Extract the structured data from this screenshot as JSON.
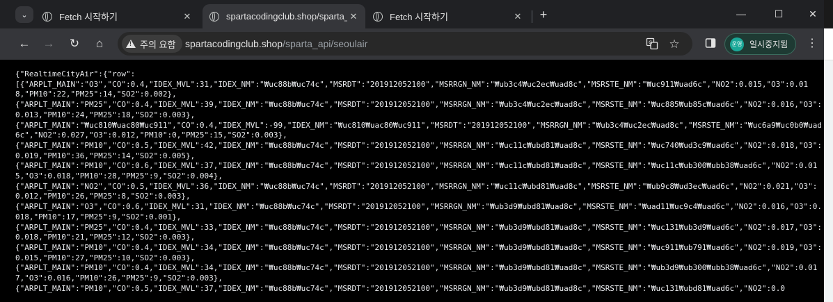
{
  "tabs": [
    {
      "title": "Fetch 시작하기"
    },
    {
      "title": "spartacodingclub.shop/sparta_"
    },
    {
      "title": "Fetch 시작하기"
    }
  ],
  "tabstrip": {
    "search_icon": "chevron-down-icon",
    "close": "✕",
    "new_tab": "+",
    "minimize": "—",
    "maximize": "☐",
    "window_close": "✕"
  },
  "toolbar": {
    "back": "←",
    "forward": "→",
    "reload": "↻",
    "home": "⌂"
  },
  "omnibox": {
    "security_label": "주의 요함",
    "url_host": "spartacodingclub.shop",
    "url_path": "/sparta_api/seoulair"
  },
  "profile": {
    "avatar_text": "운영",
    "label": "일시중지됨"
  },
  "page": {
    "json_text": "{\"RealtimeCityAir\":{\"row\":\n[{\"ARPLT_MAIN\":\"O3\",\"CO\":0.4,\"IDEX_MVL\":31,\"IDEX_NM\":\"₩uc88b₩uc74c\",\"MSRDT\":\"201912052100\",\"MSRRGN_NM\":\"₩ub3c4₩uc2ec₩uad8c\",\"MSRSTE_NM\":\"₩uc911₩uad6c\",\"NO2\":0.015,\"O3\":0.018,\"PM10\":22,\"PM25\":14,\"SO2\":0.002},\n{\"ARPLT_MAIN\":\"PM25\",\"CO\":0.4,\"IDEX_MVL\":39,\"IDEX_NM\":\"₩uc88b₩uc74c\",\"MSRDT\":\"201912052100\",\"MSRRGN_NM\":\"₩ub3c4₩uc2ec₩uad8c\",\"MSRSTE_NM\":\"₩uc885₩ub85c₩uad6c\",\"NO2\":0.016,\"O3\":0.013,\"PM10\":24,\"PM25\":18,\"SO2\":0.003},\n{\"ARPLT_MAIN\":\"₩uc810₩uac80₩uc911\",\"CO\":0.4,\"IDEX_MVL\":-99,\"IDEX_NM\":\"₩uc810₩uac80₩uc911\",\"MSRDT\":\"201912052100\",\"MSRRGN_NM\":\"₩ub3c4₩uc2ec₩uad8c\",\"MSRSTE_NM\":\"₩uc6a9₩uc0b0₩uad6c\",\"NO2\":0.027,\"O3\":0.012,\"PM10\":0,\"PM25\":15,\"SO2\":0.003},\n{\"ARPLT_MAIN\":\"PM10\",\"CO\":0.5,\"IDEX_MVL\":42,\"IDEX_NM\":\"₩uc88b₩uc74c\",\"MSRDT\":\"201912052100\",\"MSRRGN_NM\":\"₩uc11c₩ubd81₩uad8c\",\"MSRSTE_NM\":\"₩uc740₩ud3c9₩uad6c\",\"NO2\":0.018,\"O3\":0.019,\"PM10\":36,\"PM25\":14,\"SO2\":0.005},\n{\"ARPLT_MAIN\":\"PM10\",\"CO\":0.6,\"IDEX_MVL\":37,\"IDEX_NM\":\"₩uc88b₩uc74c\",\"MSRDT\":\"201912052100\",\"MSRRGN_NM\":\"₩uc11c₩ubd81₩uad8c\",\"MSRSTE_NM\":\"₩uc11c₩ub300₩ubb38₩uad6c\",\"NO2\":0.015,\"O3\":0.018,\"PM10\":28,\"PM25\":9,\"SO2\":0.004},\n{\"ARPLT_MAIN\":\"NO2\",\"CO\":0.5,\"IDEX_MVL\":36,\"IDEX_NM\":\"₩uc88b₩uc74c\",\"MSRDT\":\"201912052100\",\"MSRRGN_NM\":\"₩uc11c₩ubd81₩uad8c\",\"MSRSTE_NM\":\"₩ub9c8₩ud3ec₩uad6c\",\"NO2\":0.021,\"O3\":0.012,\"PM10\":26,\"PM25\":8,\"SO2\":0.003},\n{\"ARPLT_MAIN\":\"O3\",\"CO\":0.6,\"IDEX_MVL\":31,\"IDEX_NM\":\"₩uc88b₩uc74c\",\"MSRDT\":\"201912052100\",\"MSRRGN_NM\":\"₩ub3d9₩ubd81₩uad8c\",\"MSRSTE_NM\":\"₩uad11₩uc9c4₩uad6c\",\"NO2\":0.016,\"O3\":0.018,\"PM10\":17,\"PM25\":9,\"SO2\":0.001},\n{\"ARPLT_MAIN\":\"PM25\",\"CO\":0.4,\"IDEX_MVL\":33,\"IDEX_NM\":\"₩uc88b₩uc74c\",\"MSRDT\":\"201912052100\",\"MSRRGN_NM\":\"₩ub3d9₩ubd81₩uad8c\",\"MSRSTE_NM\":\"₩uc131₩ub3d9₩uad6c\",\"NO2\":0.017,\"O3\":0.018,\"PM10\":21,\"PM25\":12,\"SO2\":0.003},\n{\"ARPLT_MAIN\":\"PM10\",\"CO\":0.4,\"IDEX_MVL\":34,\"IDEX_NM\":\"₩uc88b₩uc74c\",\"MSRDT\":\"201912052100\",\"MSRRGN_NM\":\"₩ub3d9₩ubd81₩uad8c\",\"MSRSTE_NM\":\"₩uc911₩ub791₩uad6c\",\"NO2\":0.019,\"O3\":0.015,\"PM10\":27,\"PM25\":10,\"SO2\":0.003},\n{\"ARPLT_MAIN\":\"PM10\",\"CO\":0.4,\"IDEX_MVL\":34,\"IDEX_NM\":\"₩uc88b₩uc74c\",\"MSRDT\":\"201912052100\",\"MSRRGN_NM\":\"₩ub3d9₩ubd81₩uad8c\",\"MSRSTE_NM\":\"₩ub3d9₩ub300₩ubb38₩uad6c\",\"NO2\":0.017,\"O3\":0.016,\"PM10\":26,\"PM25\":9,\"SO2\":0.003},\n{\"ARPLT_MAIN\":\"PM10\",\"CO\":0.5,\"IDEX_MVL\":37,\"IDEX_NM\":\"₩uc88b₩uc74c\",\"MSRDT\":\"201912052100\",\"MSRRGN_NM\":\"₩ub3d9₩ubd81₩uad8c\",\"MSRSTE_NM\":\"₩uc131₩ubd81₩uad6c\",\"NO2\":0.0"
  }
}
